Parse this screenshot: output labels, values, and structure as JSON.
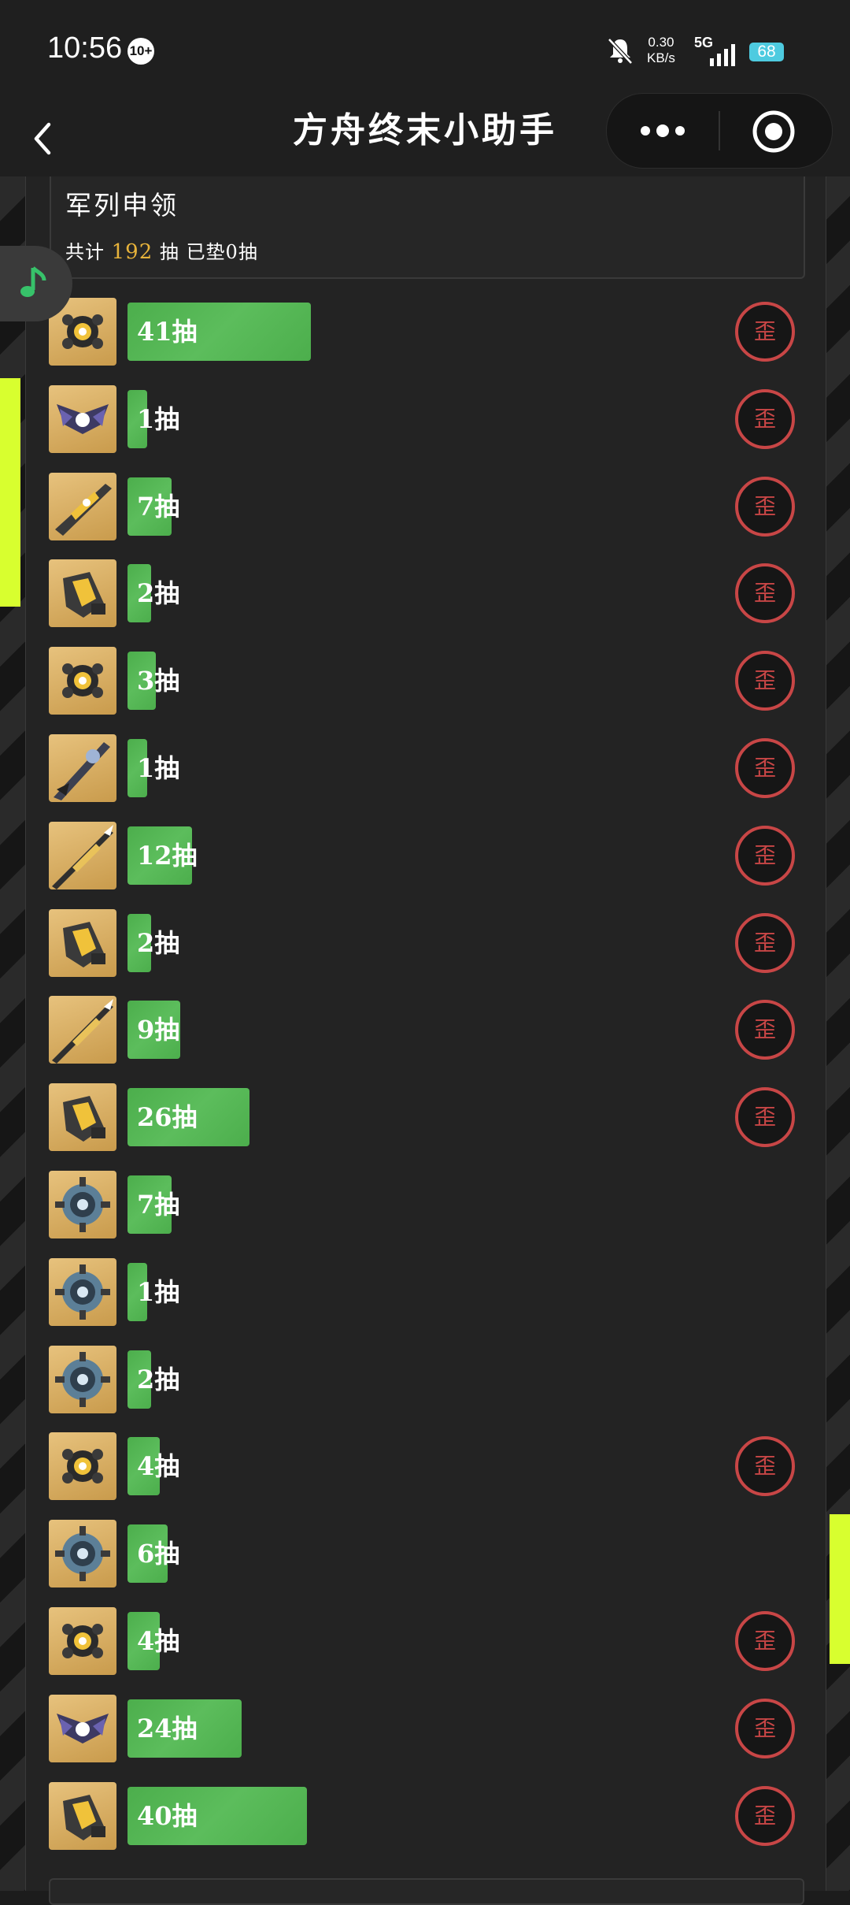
{
  "status_bar": {
    "time": "10:56",
    "badge": "10+",
    "net_speed_value": "0.30",
    "net_speed_unit": "KB/s",
    "network": "5G",
    "battery": "68"
  },
  "nav": {
    "title": "方舟终末小助手"
  },
  "pool": {
    "name": "军列申领",
    "total_prefix": "共计",
    "total_count": "192",
    "total_suffix": "抽",
    "pity_text": "已垫0抽"
  },
  "seal_char": "歪",
  "colors": {
    "bar_green": "#4cae4c",
    "seal_red": "#c84646",
    "count_gold": "#e7b33b",
    "accent_yellow": "#d8ff2f"
  },
  "records": [
    {
      "label": "41抽",
      "pulls": 41,
      "icon": "gold-drone-icon",
      "off_banner": true
    },
    {
      "label": "1抽",
      "pulls": 1,
      "icon": "purple-drone-icon",
      "off_banner": true
    },
    {
      "label": "7抽",
      "pulls": 7,
      "icon": "gold-rifle-icon",
      "off_banner": true
    },
    {
      "label": "2抽",
      "pulls": 2,
      "icon": "gold-gauntlet-icon",
      "off_banner": true
    },
    {
      "label": "3抽",
      "pulls": 3,
      "icon": "gold-drone-icon",
      "off_banner": true
    },
    {
      "label": "1抽",
      "pulls": 1,
      "icon": "blue-blade-icon",
      "off_banner": true
    },
    {
      "label": "12抽",
      "pulls": 12,
      "icon": "gold-lance-icon",
      "off_banner": true
    },
    {
      "label": "2抽",
      "pulls": 2,
      "icon": "gold-gauntlet-icon",
      "off_banner": true
    },
    {
      "label": "9抽",
      "pulls": 9,
      "icon": "gold-lance-icon",
      "off_banner": true
    },
    {
      "label": "26抽",
      "pulls": 26,
      "icon": "gold-gauntlet-icon",
      "off_banner": true
    },
    {
      "label": "7抽",
      "pulls": 7,
      "icon": "blue-core-icon",
      "off_banner": false
    },
    {
      "label": "1抽",
      "pulls": 1,
      "icon": "blue-core-icon",
      "off_banner": false
    },
    {
      "label": "2抽",
      "pulls": 2,
      "icon": "blue-core-icon",
      "off_banner": false
    },
    {
      "label": "4抽",
      "pulls": 4,
      "icon": "gold-drone-icon",
      "off_banner": true
    },
    {
      "label": "6抽",
      "pulls": 6,
      "icon": "blue-core-icon",
      "off_banner": false
    },
    {
      "label": "4抽",
      "pulls": 4,
      "icon": "gold-drone-icon",
      "off_banner": true
    },
    {
      "label": "24抽",
      "pulls": 24,
      "icon": "purple-drone-icon",
      "off_banner": true
    },
    {
      "label": "40抽",
      "pulls": 40,
      "icon": "gold-gauntlet-icon",
      "off_banner": true
    }
  ]
}
